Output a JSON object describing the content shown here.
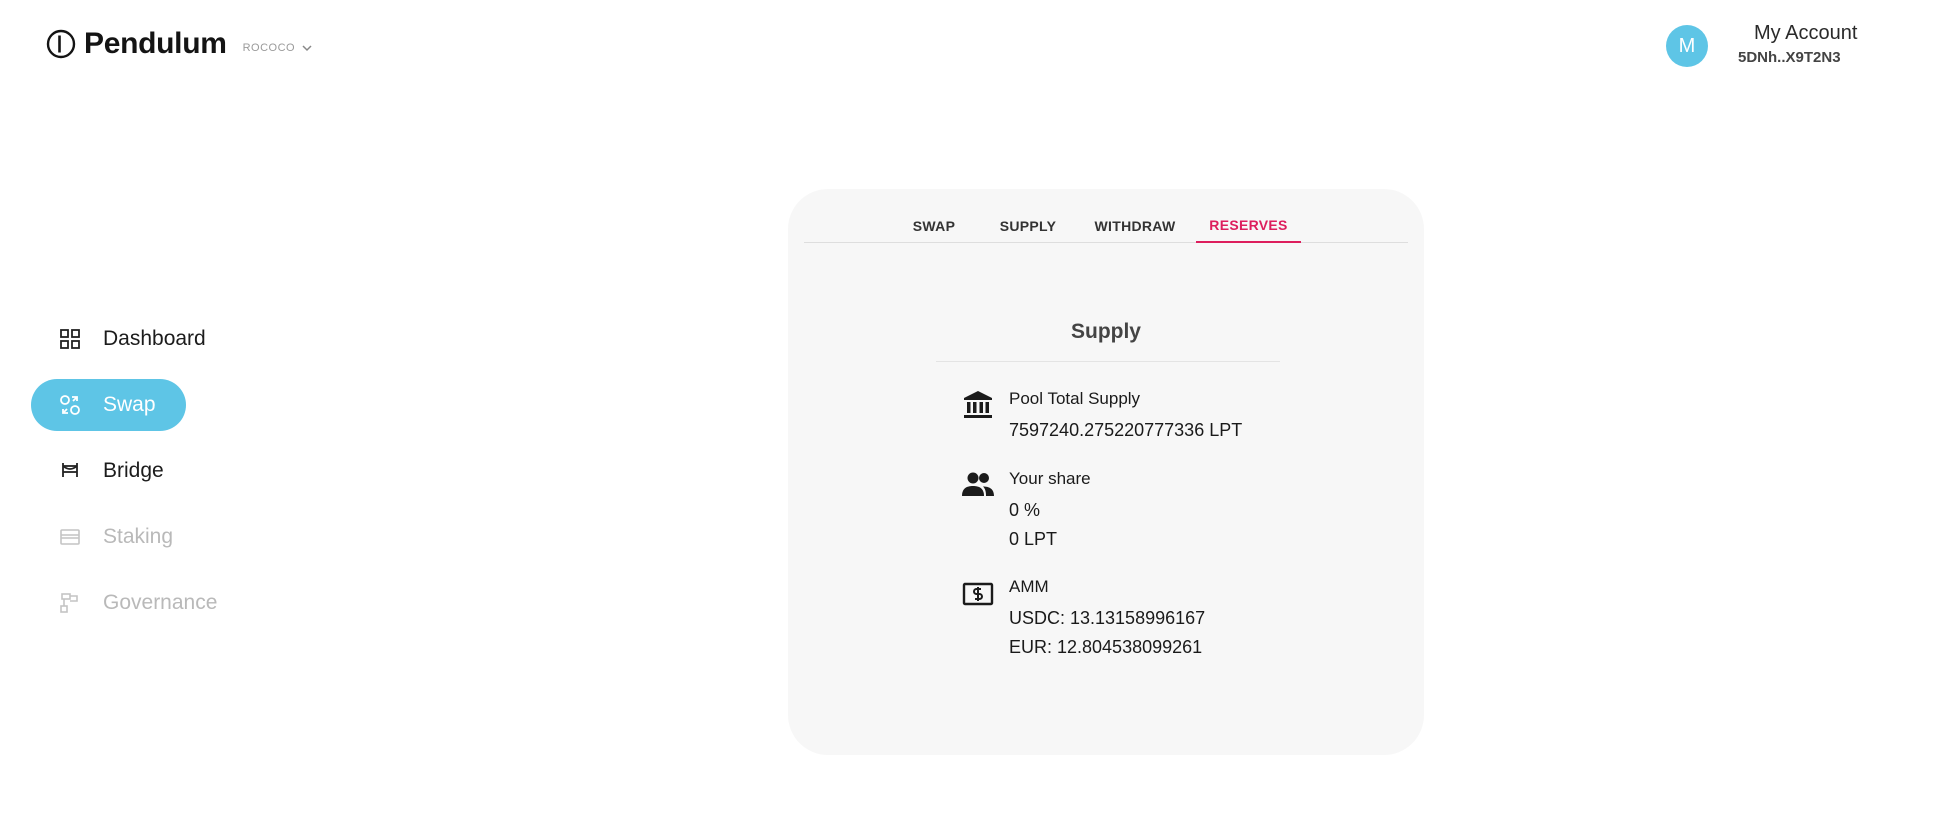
{
  "brand": {
    "name": "Pendulum",
    "network": "ROCOCO"
  },
  "account": {
    "avatar_letter": "M",
    "title": "My Account",
    "address": "5DNh..X9T2N3"
  },
  "sidebar": {
    "items": [
      {
        "label": "Dashboard",
        "icon": "grid-icon",
        "state": "normal"
      },
      {
        "label": "Swap",
        "icon": "swap-icon",
        "state": "active"
      },
      {
        "label": "Bridge",
        "icon": "bridge-icon",
        "state": "normal"
      },
      {
        "label": "Staking",
        "icon": "card-icon",
        "state": "disabled"
      },
      {
        "label": "Governance",
        "icon": "governance-icon",
        "state": "disabled"
      }
    ]
  },
  "tabs": [
    {
      "label": "SWAP",
      "active": false
    },
    {
      "label": "SUPPLY",
      "active": false
    },
    {
      "label": "WITHDRAW",
      "active": false
    },
    {
      "label": "RESERVES",
      "active": true
    }
  ],
  "panel": {
    "title": "Supply",
    "pool_total": {
      "label": "Pool Total Supply",
      "value": "7597240.275220777336 LPT"
    },
    "share": {
      "label": "Your share",
      "percent": "0 %",
      "lpt": "0 LPT"
    },
    "amm": {
      "label": "AMM",
      "usdc": "USDC: 13.13158996167",
      "eur": "EUR: 12.804538099261"
    }
  },
  "colors": {
    "accent": "#5ec5e6",
    "active_tab": "#dd1e5d",
    "card_bg": "#f7f7f7"
  }
}
